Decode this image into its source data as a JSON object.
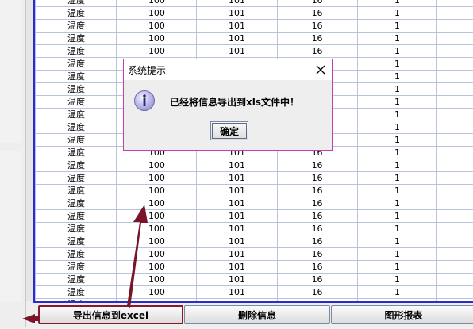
{
  "table": {
    "row_label": "温度",
    "col1": "100",
    "col2": "101",
    "col3": "16",
    "col4": "1",
    "rows": 25
  },
  "buttons": {
    "export_label": "导出信息到excel",
    "delete_label": "删除信息",
    "chart_label": "图形报表"
  },
  "dialog": {
    "title": "系统提示",
    "message": "已经将信息导出到xls文件中！",
    "ok_label": "确定"
  },
  "colors": {
    "selection_border": "#2b2bd6",
    "annotation_arrow": "#7a1428",
    "dialog_border": "#c83cb4"
  },
  "icons": [
    "info-icon",
    "close-icon",
    "annotation-arrow"
  ]
}
